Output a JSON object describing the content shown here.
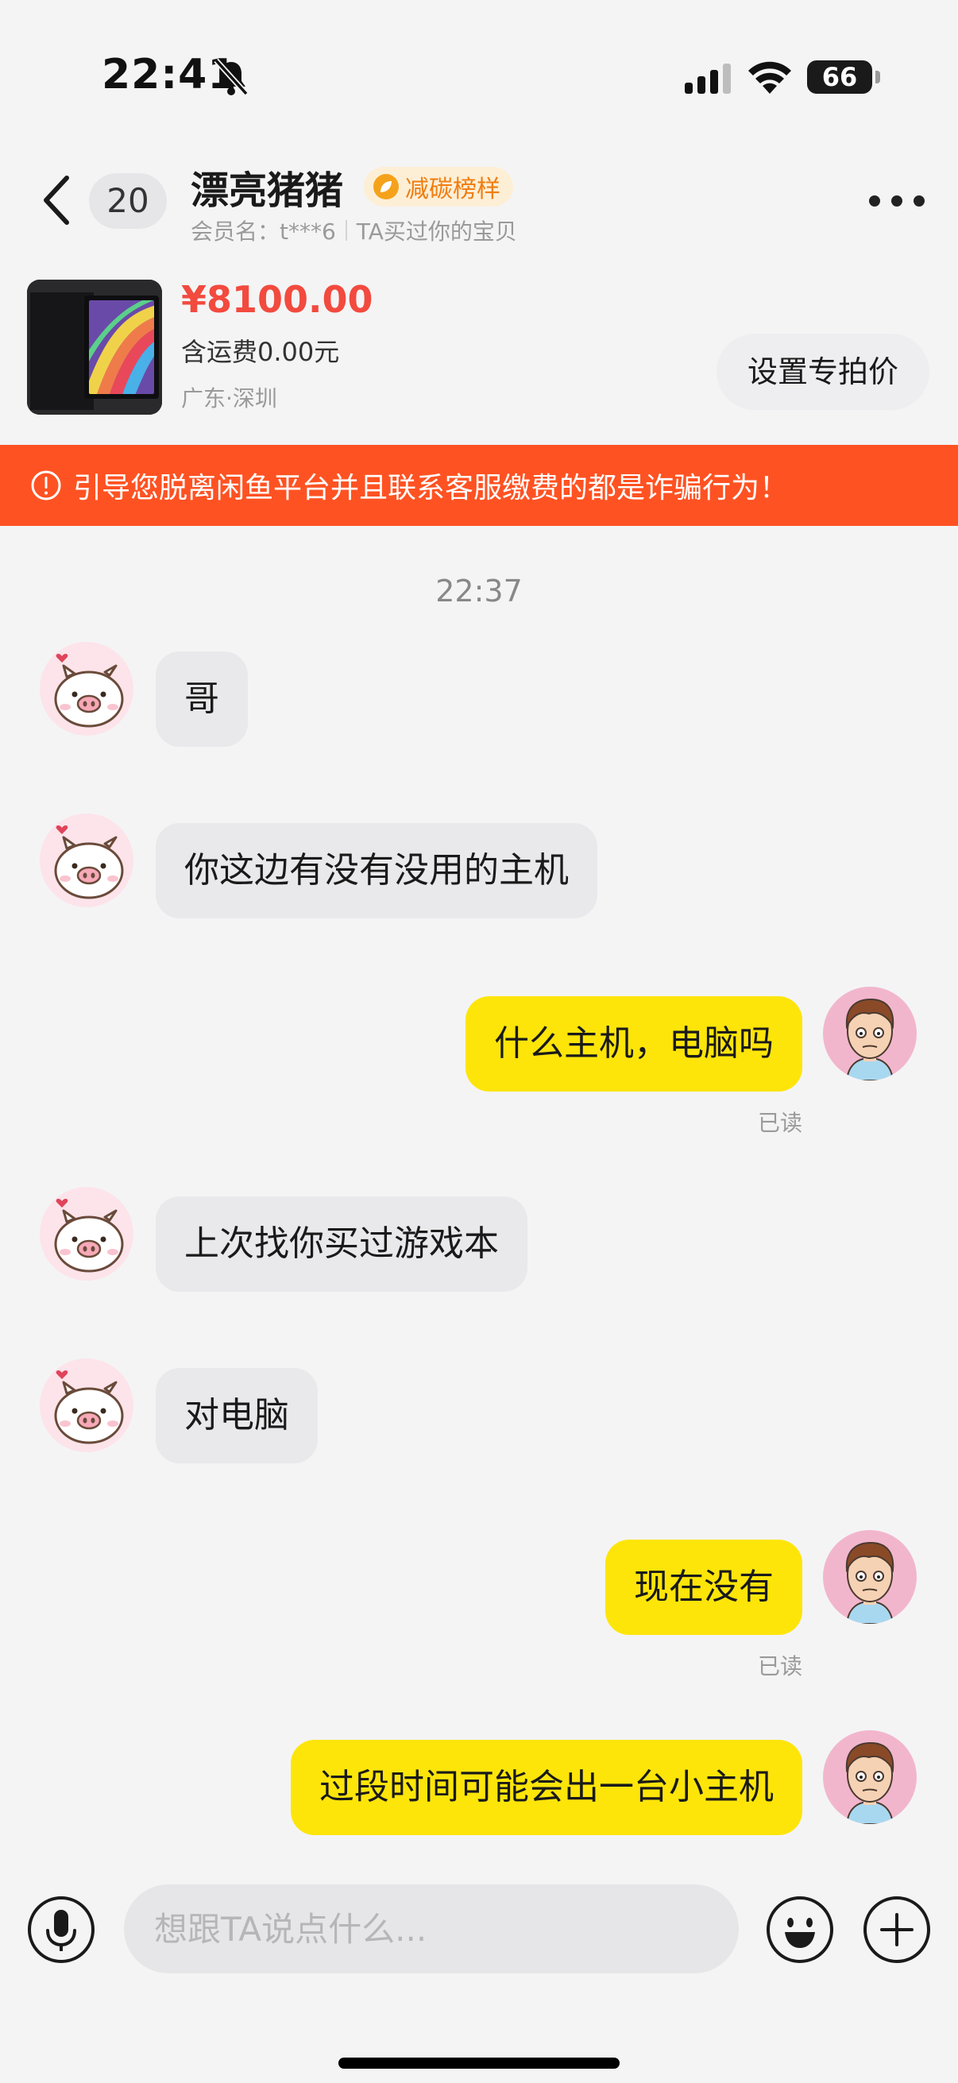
{
  "status_bar": {
    "time": "22:41",
    "battery": "66"
  },
  "header": {
    "unread_count": "20",
    "contact_name": "漂亮猪猪",
    "badge_label": "减碳榜样",
    "member_label": "会员名：t***6",
    "relation_label": "TA买过你的宝贝"
  },
  "product": {
    "price": "¥8100.00",
    "shipping": "含运费0.00元",
    "location": "广东·深圳",
    "set_price_label": "设置专拍价"
  },
  "warning": {
    "text": "引导您脱离闲鱼平台并且联系客服缴费的都是诈骗行为！"
  },
  "chat": {
    "timestamp": "22:37",
    "messages": [
      {
        "side": "in",
        "text": "哥"
      },
      {
        "side": "in",
        "text": "你这边有没有没用的主机"
      },
      {
        "side": "out",
        "text": "什么主机，电脑吗",
        "status": "已读"
      },
      {
        "side": "in",
        "text": "上次找你买过游戏本"
      },
      {
        "side": "in",
        "text": "对电脑"
      },
      {
        "side": "out",
        "text": "现在没有",
        "status": "已读"
      },
      {
        "side": "out",
        "text": "过段时间可能会出一台小主机"
      }
    ]
  },
  "input": {
    "placeholder": "想跟TA说点什么..."
  },
  "icons": {
    "back": "chevron-left-icon",
    "more": "more-dots-icon",
    "voice": "microphone-icon",
    "emoji": "smiley-icon",
    "plus": "plus-icon",
    "warning": "exclamation-circle-icon"
  },
  "colors": {
    "warning_bg": "#ff5222",
    "price": "#f24a3e",
    "out_bubble": "#fde50a",
    "in_bubble": "#e9e9eb",
    "badge_text": "#f07d10"
  }
}
